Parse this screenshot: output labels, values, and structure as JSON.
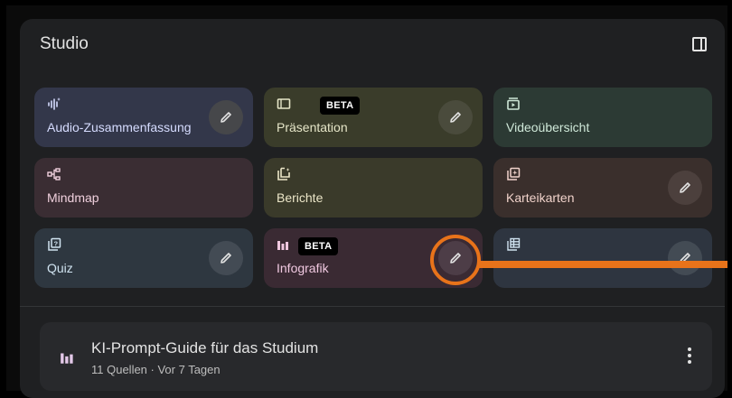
{
  "studio": {
    "title": "Studio",
    "cards": [
      {
        "label": "Audio-Zusammenfassung",
        "icon": "audio-sparkle-icon",
        "bg": "#33374a",
        "text": "#d6dcff"
      },
      {
        "label": "Präsentation",
        "icon": "slides-icon",
        "badge": "BETA",
        "bg": "#3a3c2a",
        "text": "#e6e6c8"
      },
      {
        "label": "Videoübersicht",
        "icon": "video-icon",
        "bg": "#2c3a34",
        "text": "#cfe8d8"
      },
      {
        "label": "Mindmap",
        "icon": "mindmap-icon",
        "bg": "#3a2d33",
        "text": "#f0d0dd"
      },
      {
        "label": "Berichte",
        "icon": "reports-icon",
        "bg": "#3a3a2a",
        "text": "#ece6c8"
      },
      {
        "label": "Karteikarten",
        "icon": "flashcards-icon",
        "bg": "#3a2f2c",
        "text": "#f1d3cb"
      },
      {
        "label": "Quiz",
        "icon": "quiz-icon",
        "bg": "#2e3740",
        "text": "#d0e3f0"
      },
      {
        "label": "Infografik",
        "icon": "infographic-icon",
        "badge": "BETA",
        "bg": "#3a2a33",
        "text": "#f0c8e0"
      },
      {
        "label": "",
        "icon": "table-icon",
        "bg": "#2e3540",
        "text": "#d0e3f0"
      }
    ]
  },
  "notebook": {
    "title": "KI-Prompt-Guide für das Studium",
    "subtitle": "11 Quellen · Vor 7 Tagen"
  },
  "accent_color": "#e8731a"
}
